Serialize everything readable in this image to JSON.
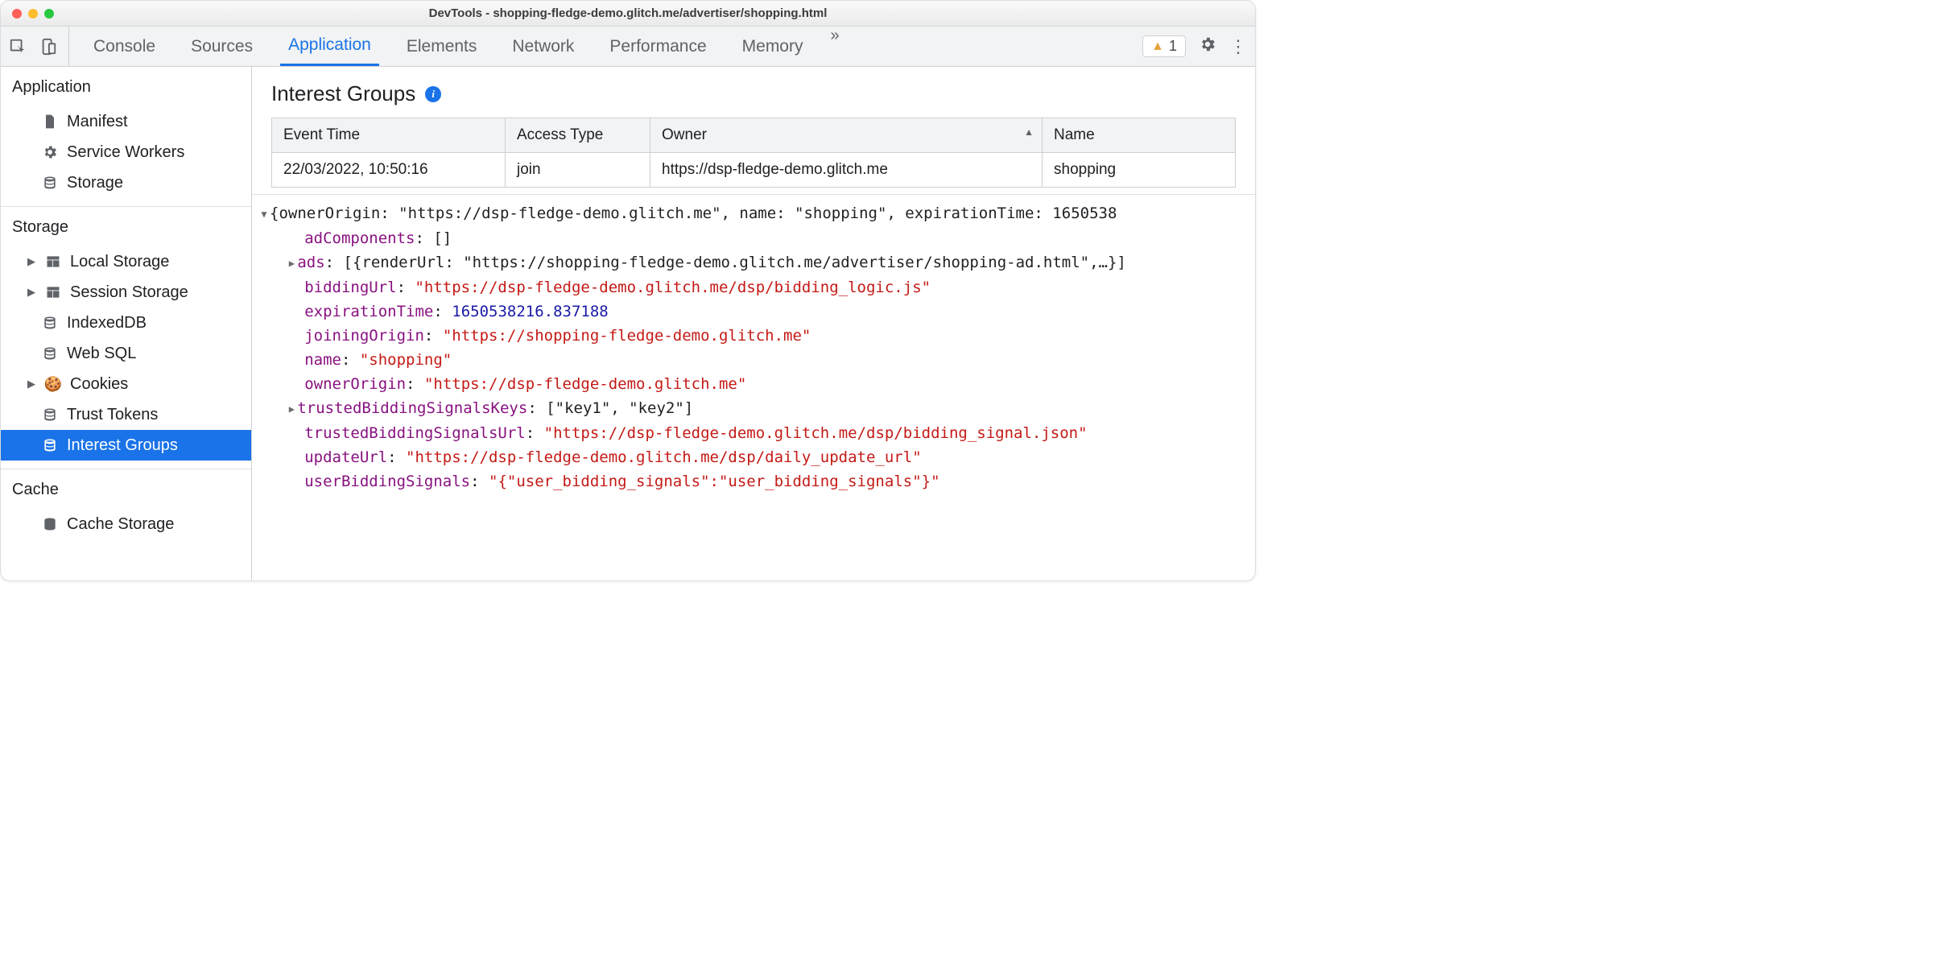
{
  "window_title": "DevTools - shopping-fledge-demo.glitch.me/advertiser/shopping.html",
  "toolbar": {
    "tabs": [
      "Console",
      "Sources",
      "Application",
      "Elements",
      "Network",
      "Performance",
      "Memory"
    ],
    "active_tab": "Application",
    "warning_count": "1"
  },
  "sidebar": {
    "groups": [
      {
        "title": "Application",
        "items": [
          {
            "label": "Manifest",
            "icon": "file"
          },
          {
            "label": "Service Workers",
            "icon": "gear"
          },
          {
            "label": "Storage",
            "icon": "db"
          }
        ]
      },
      {
        "title": "Storage",
        "items": [
          {
            "label": "Local Storage",
            "icon": "grid",
            "expandable": true
          },
          {
            "label": "Session Storage",
            "icon": "grid",
            "expandable": true
          },
          {
            "label": "IndexedDB",
            "icon": "db"
          },
          {
            "label": "Web SQL",
            "icon": "db"
          },
          {
            "label": "Cookies",
            "icon": "cookie",
            "expandable": true
          },
          {
            "label": "Trust Tokens",
            "icon": "db"
          },
          {
            "label": "Interest Groups",
            "icon": "db",
            "selected": true
          }
        ]
      },
      {
        "title": "Cache",
        "items": [
          {
            "label": "Cache Storage",
            "icon": "db"
          }
        ]
      }
    ]
  },
  "main": {
    "title": "Interest Groups",
    "table": {
      "columns": [
        "Event Time",
        "Access Type",
        "Owner",
        "Name"
      ],
      "sort_col": 2,
      "rows": [
        [
          "22/03/2022, 10:50:16",
          "join",
          "https://dsp-fledge-demo.glitch.me",
          "shopping"
        ]
      ]
    },
    "json": {
      "summary": "{ownerOrigin: \"https://dsp-fledge-demo.glitch.me\", name: \"shopping\", expirationTime: 1650538",
      "adComponents": "[]",
      "ads_summary": "[{renderUrl: \"https://shopping-fledge-demo.glitch.me/advertiser/shopping-ad.html\",…}]",
      "biddingUrl": "\"https://dsp-fledge-demo.glitch.me/dsp/bidding_logic.js\"",
      "expirationTime": "1650538216.837188",
      "joiningOrigin": "\"https://shopping-fledge-demo.glitch.me\"",
      "name": "\"shopping\"",
      "ownerOrigin": "\"https://dsp-fledge-demo.glitch.me\"",
      "trustedBiddingSignalsKeys": "[\"key1\", \"key2\"]",
      "trustedBiddingSignalsUrl": "\"https://dsp-fledge-demo.glitch.me/dsp/bidding_signal.json\"",
      "updateUrl": "\"https://dsp-fledge-demo.glitch.me/dsp/daily_update_url\"",
      "userBiddingSignals": "\"{\\\"user_bidding_signals\\\":\\\"user_bidding_signals\\\"}\""
    }
  }
}
